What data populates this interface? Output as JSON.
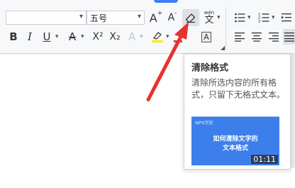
{
  "toolbar": {
    "font_name": "",
    "font_size": "五号",
    "grow_font": "A",
    "grow_font_mark": "+",
    "shrink_font": "A",
    "shrink_font_mark": "-",
    "pinyin_label": "wén",
    "pinyin_char": "文",
    "bold": "B",
    "italic": "I",
    "underline": "U",
    "strikethrough": "A",
    "superscript": "X²",
    "subscript": "X₂",
    "text_effect": "A",
    "char_shading": "A"
  },
  "tooltip": {
    "title": "清除格式",
    "description": "清除所选内容的所有格式，只留下无格式文本。",
    "video": {
      "brand": "WPS学院",
      "title_line1": "如何清除文字的",
      "title_line2": "文本格式",
      "duration": "01:11"
    }
  },
  "colors": {
    "accent": "#3f7ef7",
    "arrow": "#e8322d",
    "thumb_bg": "#3d7fea",
    "highlight_yellow": "#ffea00",
    "font_color_red": "#e53935"
  }
}
